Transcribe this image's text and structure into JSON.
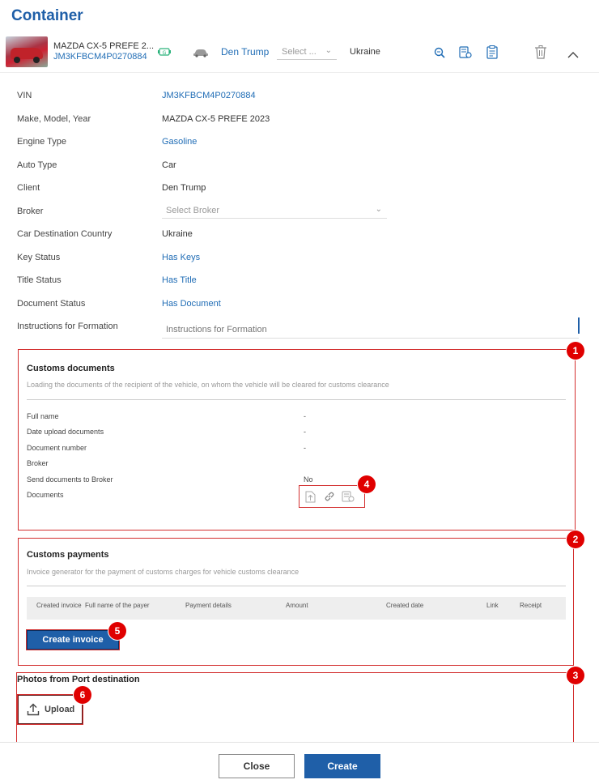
{
  "page": {
    "title": "Container"
  },
  "car": {
    "name": "MAZDA CX-5 PREFE 2...",
    "vin": "JM3KFBCM4P0270884",
    "client": "Den Trump",
    "select_placeholder": "Select ...",
    "country": "Ukraine"
  },
  "details": {
    "vin_label": "VIN",
    "vin_value": "JM3KFBCM4P0270884",
    "mmy_label": "Make, Model, Year",
    "mmy_value": "MAZDA CX-5 PREFE 2023",
    "engine_label": "Engine Type",
    "engine_value": "Gasoline",
    "auto_label": "Auto Type",
    "auto_value": "Car",
    "client_label": "Client",
    "client_value": "Den Trump",
    "broker_label": "Broker",
    "broker_placeholder": "Select Broker",
    "dest_label": "Car Destination Country",
    "dest_value": "Ukraine",
    "key_label": "Key Status",
    "key_value": "Has Keys",
    "title_label": "Title Status",
    "title_value": "Has Title",
    "doc_label": "Document Status",
    "doc_value": "Has Document",
    "instr_label": "Instructions for Formation",
    "instr_placeholder": "Instructions for Formation"
  },
  "customs_documents": {
    "title": "Customs documents",
    "subtitle": "Loading the documents of the recipient of the vehicle, on whom the vehicle will be cleared for customs clearance",
    "rows": [
      {
        "label": "Full name",
        "value": "-"
      },
      {
        "label": "Date upload documents",
        "value": "-"
      },
      {
        "label": "Document number",
        "value": "-"
      },
      {
        "label": "Broker",
        "value": ""
      },
      {
        "label": "Send documents to Broker",
        "value": "No"
      },
      {
        "label": "Documents",
        "value": ""
      }
    ]
  },
  "customs_payments": {
    "title": "Customs payments",
    "subtitle": "Invoice generator for the payment of customs charges for vehicle customs clearance",
    "columns": [
      "Created invoice",
      "Full name of the payer",
      "Payment details",
      "Amount",
      "Created date",
      "Link",
      "Receipt"
    ],
    "create_invoice_label": "Create invoice"
  },
  "photos": {
    "title": "Photos from Port destination",
    "upload_label": "Upload"
  },
  "badges": [
    "1",
    "2",
    "3",
    "4",
    "5",
    "6"
  ],
  "footer": {
    "close_label": "Close",
    "create_label": "Create"
  },
  "colors": {
    "accent": "#1f5fa8",
    "link": "#1f6cb5",
    "annotation": "#e00000"
  }
}
